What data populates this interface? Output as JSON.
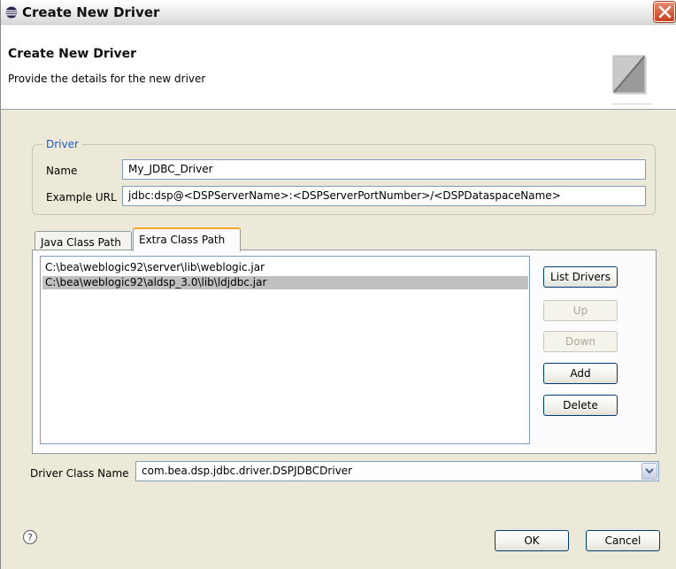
{
  "window": {
    "title": "Create New Driver"
  },
  "header": {
    "title": "Create New Driver",
    "description": "Provide the details for the new driver"
  },
  "driver_group": {
    "label": "Driver",
    "name_label": "Name",
    "name_value": "My_JDBC_Driver",
    "url_label": "Example URL",
    "url_value": "jdbc:dsp@<DSPServerName>:<DSPServerPortNumber>/<DSPDataspaceName>"
  },
  "tabs": [
    {
      "label": "Java Class Path",
      "active": false
    },
    {
      "label": "Extra Class Path",
      "active": true
    }
  ],
  "class_path_list": [
    {
      "path": "C:\\bea\\weblogic92\\server\\lib\\weblogic.jar",
      "selected": false
    },
    {
      "path": "C:\\bea\\weblogic92\\aldsp_3.0\\lib\\ldjdbc.jar",
      "selected": true
    }
  ],
  "side_buttons": {
    "list_drivers": "List Drivers",
    "up": "Up",
    "down": "Down",
    "add": "Add",
    "delete": "Delete"
  },
  "driver_class": {
    "label": "Driver Class Name",
    "value": "com.bea.dsp.jdbc.driver.DSPJDBCDriver"
  },
  "footer": {
    "ok": "OK",
    "cancel": "Cancel"
  },
  "icons": {
    "title": "eclipse-icon",
    "close": "close-icon",
    "wizard": "wizard-banner-icon",
    "help": "help-icon",
    "dropdown": "chevron-down-icon"
  },
  "colors": {
    "dialog_bg": "#ece9d8",
    "group_label": "#1e5bc6",
    "active_tab_accent": "#f5a623",
    "selection": "#c0c0c0"
  }
}
